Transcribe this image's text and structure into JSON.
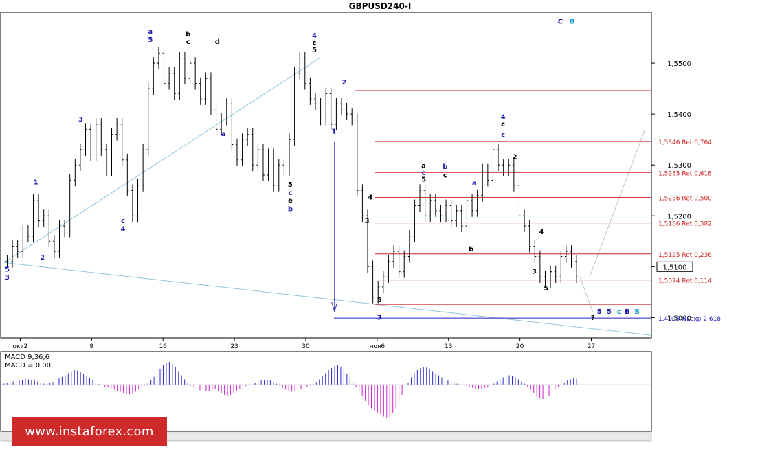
{
  "chart_data": {
    "type": "candlestick",
    "title": "GBPUSD240-I",
    "x_ticks": [
      "окт2",
      "9",
      "16",
      "23",
      "30",
      "ноя6",
      "13",
      "20",
      "27"
    ],
    "y_ticks": [
      "1,5000",
      "1,5100",
      "1,5200",
      "1,5300",
      "1,5400",
      "1,5500"
    ],
    "y_tick_values": [
      1.5,
      1.51,
      1.52,
      1.53,
      1.54,
      1.55
    ],
    "ylim": [
      1.496,
      1.56
    ],
    "current_price": "1,5100",
    "price_path": [
      1.511,
      1.514,
      1.513,
      1.517,
      1.516,
      1.523,
      1.519,
      1.52,
      1.515,
      1.513,
      1.518,
      1.517,
      1.527,
      1.53,
      1.533,
      1.537,
      1.532,
      1.538,
      1.533,
      1.529,
      1.536,
      1.538,
      1.531,
      1.525,
      1.52,
      1.526,
      1.533,
      1.545,
      1.55,
      1.552,
      1.546,
      1.548,
      1.544,
      1.551,
      1.547,
      1.55,
      1.546,
      1.543,
      1.547,
      1.541,
      1.537,
      1.539,
      1.542,
      1.534,
      1.531,
      1.535,
      1.536,
      1.53,
      1.533,
      1.528,
      1.532,
      1.526,
      1.53,
      1.529,
      1.535,
      1.548,
      1.551,
      1.546,
      1.543,
      1.542,
      1.539,
      1.544,
      1.538,
      1.542,
      1.541,
      1.54,
      1.539,
      1.525,
      1.52,
      1.51,
      1.504,
      1.506,
      1.508,
      1.511,
      1.513,
      1.509,
      1.512,
      1.516,
      1.522,
      1.525,
      1.52,
      1.523,
      1.521,
      1.52,
      1.522,
      1.519,
      1.521,
      1.518,
      1.523,
      1.521,
      1.524,
      1.529,
      1.527,
      1.533,
      1.53,
      1.529,
      1.53,
      1.526,
      1.52,
      1.518,
      1.514,
      1.512,
      1.508,
      1.507,
      1.509,
      1.508,
      1.512,
      1.513,
      1.511,
      1.508
    ],
    "fib_levels": [
      {
        "label": "1,5346 Ret 0,764",
        "value": 1.5346
      },
      {
        "label": "1,5285 Ret 0,618",
        "value": 1.5285
      },
      {
        "label": "1,5236 Ret 0,500",
        "value": 1.5236
      },
      {
        "label": "1,5186 Ret 0,382",
        "value": 1.5186
      },
      {
        "label": "1,5125 Ret 0,236",
        "value": 1.5125
      },
      {
        "label": "1,5074 Ret 0,114",
        "value": 1.5074
      },
      {
        "label": "",
        "value": 1.5026
      },
      {
        "label": "",
        "value": 1.5446
      }
    ],
    "hl_level": {
      "label": "1,4999 HLexp 2,618",
      "value": 1.4999
    },
    "wave_labels": [
      {
        "text": "a",
        "t": 0.23,
        "p": 1.5558,
        "color": "#1a1ab0"
      },
      {
        "text": "5",
        "t": 0.23,
        "p": 1.5542,
        "color": "#1a1ab0"
      },
      {
        "text": "b",
        "t": 0.288,
        "p": 1.5553,
        "color": "#000000"
      },
      {
        "text": "c",
        "t": 0.288,
        "p": 1.5538,
        "color": "#000000"
      },
      {
        "text": "d",
        "t": 0.333,
        "p": 1.5538,
        "color": "#000000"
      },
      {
        "text": "4",
        "t": 0.482,
        "p": 1.555,
        "color": "#1a1ab0"
      },
      {
        "text": "c",
        "t": 0.482,
        "p": 1.5536,
        "color": "#000000"
      },
      {
        "text": "5",
        "t": 0.482,
        "p": 1.5522,
        "color": "#000000"
      },
      {
        "text": "C",
        "t": 0.86,
        "p": 1.5578,
        "color": "#1a1ab0"
      },
      {
        "text": "B",
        "t": 0.878,
        "p": 1.5578,
        "color": "#1a9ad0"
      },
      {
        "text": "2",
        "t": 0.528,
        "p": 1.5458,
        "color": "#1a1ab0"
      },
      {
        "text": "1",
        "t": 0.512,
        "p": 1.5362,
        "color": "#1a1ab0"
      },
      {
        "text": "4",
        "t": 0.772,
        "p": 1.539,
        "color": "#1a1ab0"
      },
      {
        "text": "c",
        "t": 0.772,
        "p": 1.5376,
        "color": "#000000"
      },
      {
        "text": "c",
        "t": 0.772,
        "p": 1.5355,
        "color": "#1a1ab0"
      },
      {
        "text": "2",
        "t": 0.79,
        "p": 1.5312,
        "color": "#000000"
      },
      {
        "text": "a",
        "t": 0.65,
        "p": 1.5294,
        "color": "#000000"
      },
      {
        "text": "b",
        "t": 0.683,
        "p": 1.5292,
        "color": "#1a1ab0"
      },
      {
        "text": "c",
        "t": 0.65,
        "p": 1.528,
        "color": "#1a1ab0"
      },
      {
        "text": "c",
        "t": 0.683,
        "p": 1.5275,
        "color": "#000000"
      },
      {
        "text": "5",
        "t": 0.65,
        "p": 1.5267,
        "color": "#000000"
      },
      {
        "text": "a",
        "t": 0.728,
        "p": 1.526,
        "color": "#1a1ab0"
      },
      {
        "text": "3",
        "t": 0.123,
        "p": 1.5385,
        "color": "#1a1ab0"
      },
      {
        "text": "1",
        "t": 0.054,
        "p": 1.5262,
        "color": "#1a1ab0"
      },
      {
        "text": "2",
        "t": 0.064,
        "p": 1.5114,
        "color": "#1a1ab0"
      },
      {
        "text": "5",
        "t": 0.01,
        "p": 1.509,
        "color": "#1a1ab0"
      },
      {
        "text": "3",
        "t": 0.01,
        "p": 1.5075,
        "color": "#1a1ab0"
      },
      {
        "text": "4",
        "t": 0.188,
        "p": 1.517,
        "color": "#1a1ab0"
      },
      {
        "text": "c",
        "t": 0.188,
        "p": 1.5186,
        "color": "#1a1ab0"
      },
      {
        "text": "a",
        "t": 0.342,
        "p": 1.5357,
        "color": "#1a1ab0"
      },
      {
        "text": "5",
        "t": 0.445,
        "p": 1.5257,
        "color": "#000000"
      },
      {
        "text": "c",
        "t": 0.445,
        "p": 1.5241,
        "color": "#1a1ab0"
      },
      {
        "text": "e",
        "t": 0.445,
        "p": 1.5226,
        "color": "#000000"
      },
      {
        "text": "b",
        "t": 0.445,
        "p": 1.5209,
        "color": "#1a1ab0"
      },
      {
        "text": "3",
        "t": 0.563,
        "p": 1.5186,
        "color": "#000000"
      },
      {
        "text": "4",
        "t": 0.568,
        "p": 1.5232,
        "color": "#000000"
      },
      {
        "text": "5",
        "t": 0.582,
        "p": 1.503,
        "color": "#000000"
      },
      {
        "text": "3",
        "t": 0.582,
        "p": 1.4996,
        "color": "#1a1ab0"
      },
      {
        "text": "b",
        "t": 0.723,
        "p": 1.513,
        "color": "#000000"
      },
      {
        "text": "5",
        "t": 0.838,
        "p": 1.5053,
        "color": "#000000"
      },
      {
        "text": "3",
        "t": 0.82,
        "p": 1.5086,
        "color": "#000000"
      },
      {
        "text": "4",
        "t": 0.831,
        "p": 1.5164,
        "color": "#000000"
      },
      {
        "text": "?",
        "t": 0.91,
        "p": 1.4995,
        "color": "#000000"
      },
      {
        "text": "5",
        "t": 0.92,
        "p": 1.5007,
        "color": "#1a1ab0"
      },
      {
        "text": "5",
        "t": 0.935,
        "p": 1.5007,
        "color": "#1a1ab0"
      },
      {
        "text": "c",
        "t": 0.95,
        "p": 1.5007,
        "color": "#1a9ad0"
      },
      {
        "text": "B",
        "t": 0.963,
        "p": 1.5007,
        "color": "#1a1ab0"
      },
      {
        "text": "B",
        "t": 0.978,
        "p": 1.5007,
        "color": "#1a9ad0"
      }
    ],
    "macd": {
      "label_1": "MACD 9,36,6",
      "label_2": "MACD = 0,00",
      "values": [
        2,
        3,
        4,
        6,
        5,
        8,
        9,
        11,
        10,
        9,
        8,
        6,
        4,
        2,
        1,
        3,
        5,
        8,
        12,
        15,
        18,
        22,
        26,
        28,
        27,
        24,
        20,
        16,
        12,
        8,
        4,
        1,
        -2,
        -4,
        -6,
        -8,
        -10,
        -12,
        -14,
        -16,
        -18,
        -19,
        -17,
        -14,
        -10,
        -6,
        -2,
        3,
        9,
        15,
        22,
        30,
        38,
        42,
        44,
        40,
        34,
        26,
        18,
        10,
        4,
        -2,
        -6,
        -9,
        -11,
        -12,
        -13,
        -12,
        -10,
        -9,
        -12,
        -16,
        -20,
        -22,
        -20,
        -16,
        -12,
        -8,
        -5,
        -3,
        -2,
        1,
        4,
        6,
        8,
        9,
        10,
        8,
        5,
        2,
        -2,
        -6,
        -10,
        -12,
        -14,
        -13,
        -10,
        -8,
        -6,
        -4,
        -2,
        1,
        5,
        10,
        16,
        22,
        28,
        32,
        36,
        38,
        34,
        28,
        20,
        12,
        4,
        -4,
        -12,
        -22,
        -32,
        -40,
        -46,
        -50,
        -54,
        -58,
        -62,
        -64,
        -62,
        -56,
        -46,
        -34,
        -20,
        -8,
        4,
        14,
        22,
        28,
        32,
        34,
        33,
        30,
        26,
        22,
        18,
        14,
        10,
        8,
        6,
        4,
        2,
        1,
        0,
        -2,
        -4,
        -6,
        -8,
        -9,
        -8,
        -6,
        -4,
        -2,
        2,
        6,
        10,
        14,
        16,
        18,
        16,
        14,
        10,
        6,
        2,
        -4,
        -10,
        -16,
        -22,
        -26,
        -28,
        -26,
        -22,
        -16,
        -10,
        -4,
        0,
        4,
        8,
        10,
        12,
        11
      ]
    }
  },
  "watermark": "www.instaforex.com"
}
